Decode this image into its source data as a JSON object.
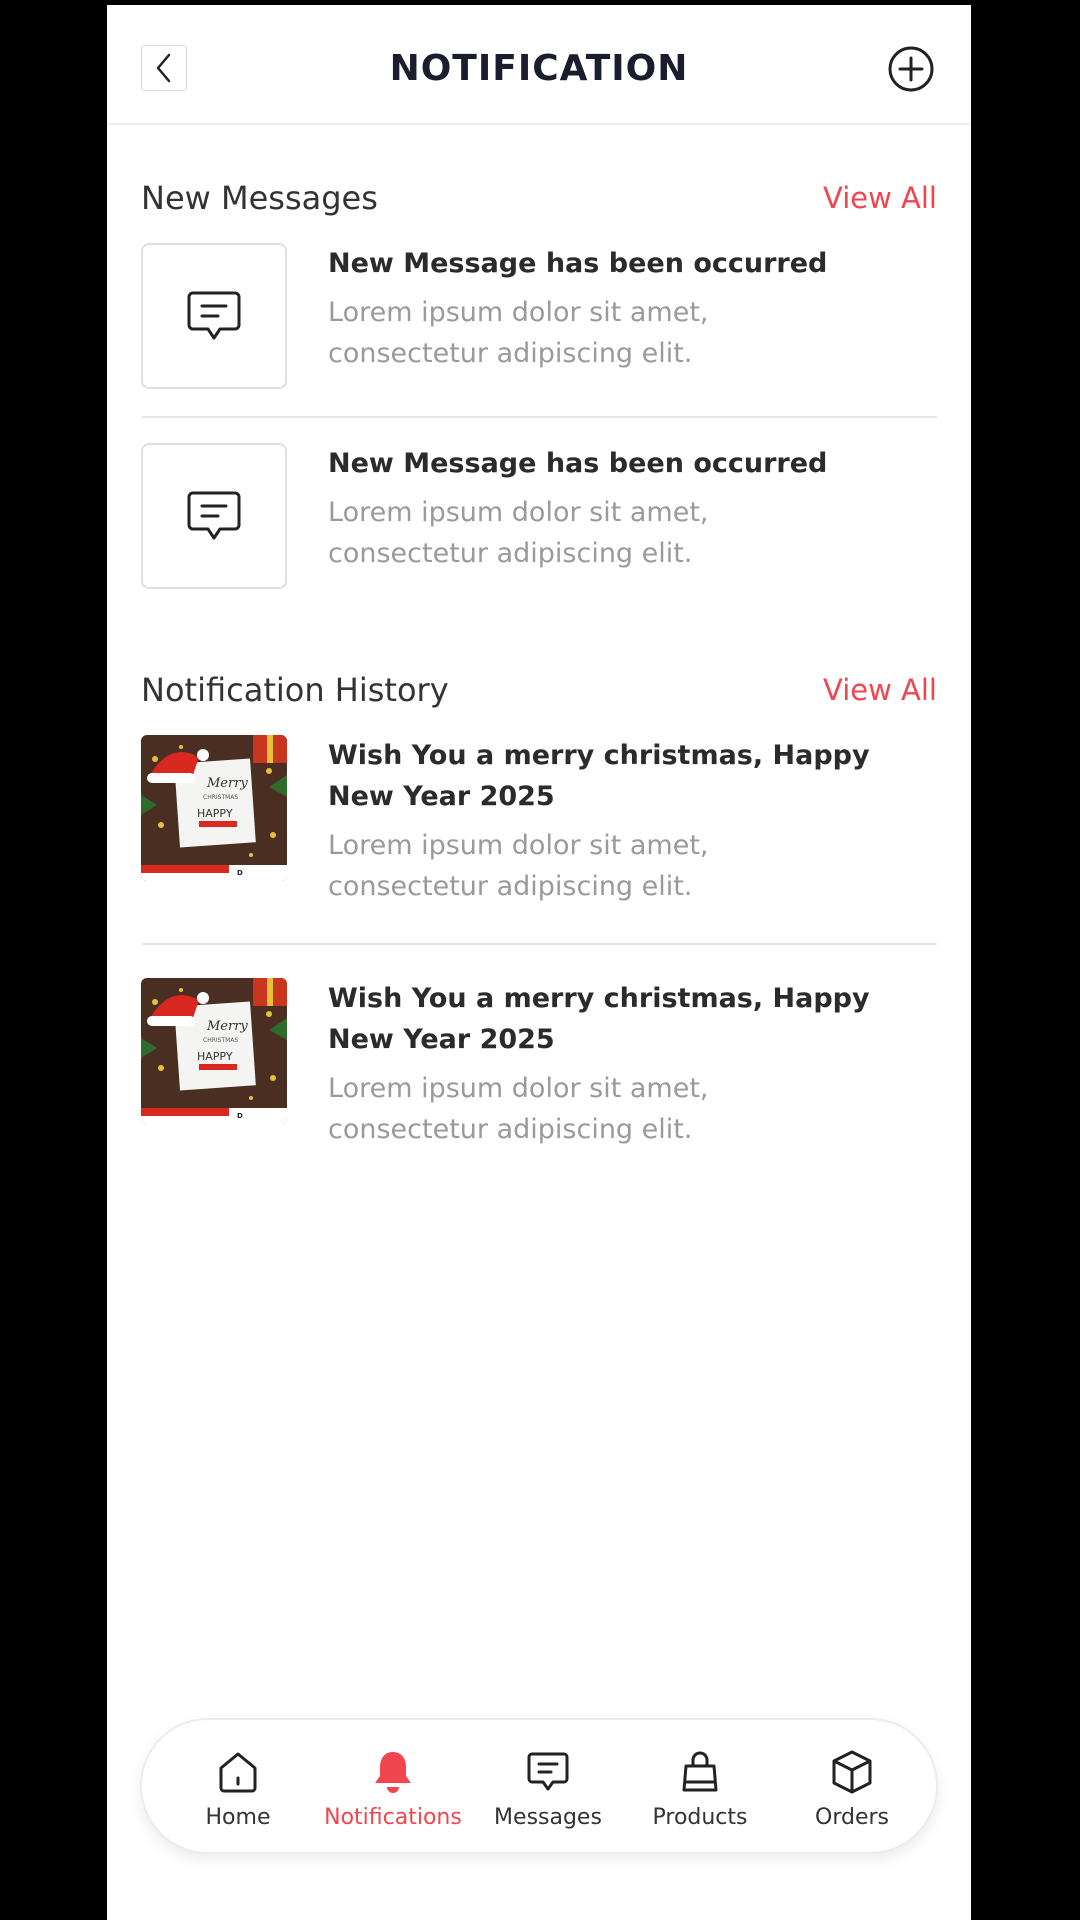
{
  "header": {
    "title": "NOTIFICATION"
  },
  "new_messages": {
    "title": "New Messages",
    "view_all": "View All",
    "items": [
      {
        "title": "New Message has been occurred",
        "desc_line1": "Lorem ipsum dolor sit amet,",
        "desc_line2": "consectetur adipiscing elit."
      },
      {
        "title": "New Message has been occurred",
        "desc_line1": "Lorem ipsum dolor sit amet,",
        "desc_line2": "consectetur adipiscing elit."
      }
    ]
  },
  "history": {
    "title": "Notification History",
    "view_all": "View All",
    "items": [
      {
        "title_line1": "Wish You a merry christmas, Happy",
        "title_line2": "New Year 2025",
        "desc_line1": "Lorem ipsum dolor sit amet,",
        "desc_line2": "consectetur adipiscing elit."
      },
      {
        "title_line1": "Wish You a merry christmas, Happy",
        "title_line2": "New Year 2025",
        "desc_line1": "Lorem ipsum dolor sit amet,",
        "desc_line2": "consectetur adipiscing elit."
      }
    ]
  },
  "nav": {
    "items": [
      {
        "label": "Home",
        "icon": "home-icon"
      },
      {
        "label": "Notifications",
        "icon": "bell-icon",
        "active": true
      },
      {
        "label": "Messages",
        "icon": "message-icon"
      },
      {
        "label": "Products",
        "icon": "bag-icon"
      },
      {
        "label": "Orders",
        "icon": "box-icon"
      }
    ]
  },
  "colors": {
    "accent": "#f0454f",
    "title": "#1a1d2e",
    "muted": "#9a9a9a"
  }
}
